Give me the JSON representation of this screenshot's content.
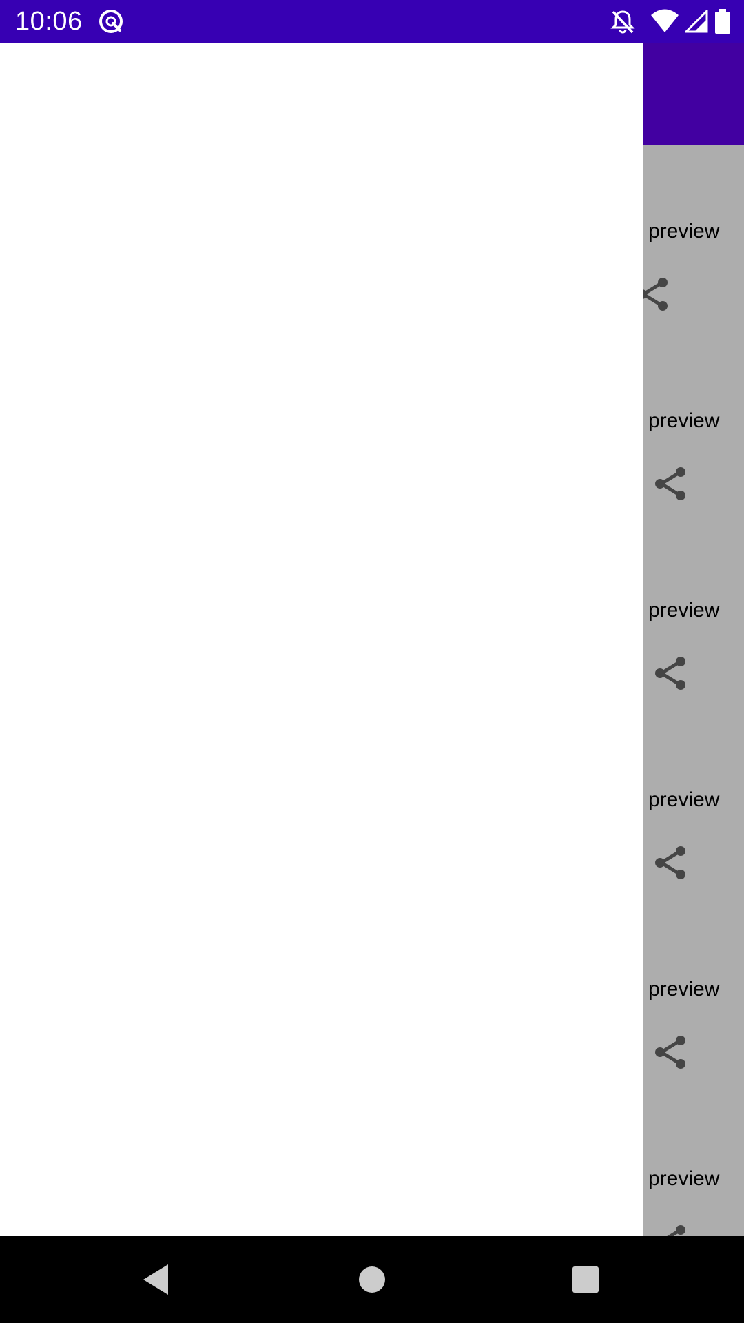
{
  "status_bar": {
    "time": "10:06",
    "icons": [
      "sync-icon",
      "notifications-off-icon",
      "wifi-icon",
      "signal-icon",
      "battery-icon"
    ],
    "background": "#3700b3"
  },
  "app": {
    "toolbar_color": "#6200ee",
    "items": [
      {
        "label": "preview",
        "icon": "share-icon"
      },
      {
        "label": "preview",
        "icon": "share-icon"
      },
      {
        "label": "preview",
        "icon": "share-icon"
      },
      {
        "label": "preview",
        "icon": "share-icon"
      },
      {
        "label": "preview",
        "icon": "share-icon"
      },
      {
        "label": "preview",
        "icon": "share-icon"
      }
    ]
  },
  "drawer": {
    "state": "open",
    "background": "#ffffff"
  },
  "nav_bar": {
    "buttons": [
      "back-icon",
      "home-icon",
      "recents-icon"
    ]
  }
}
